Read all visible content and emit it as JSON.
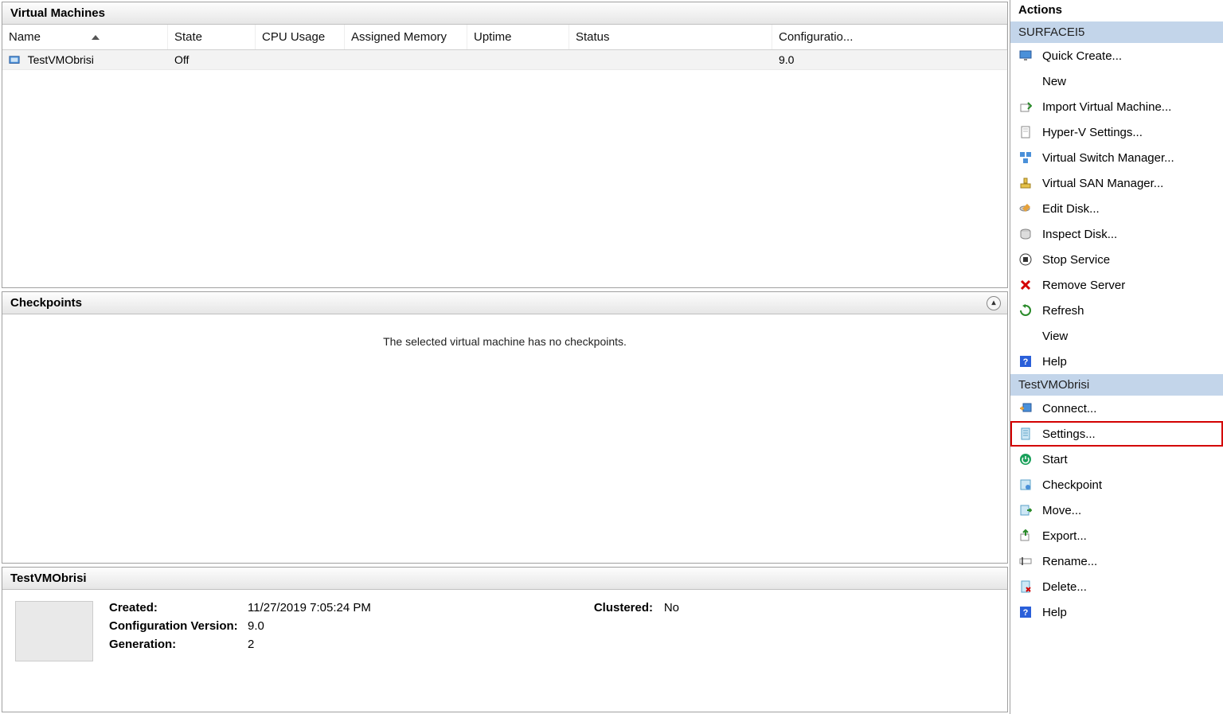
{
  "main": {
    "vm_panel_title": "Virtual Machines",
    "columns": {
      "name": "Name",
      "state": "State",
      "cpu": "CPU Usage",
      "mem": "Assigned Memory",
      "uptime": "Uptime",
      "status": "Status",
      "config": "Configuratio..."
    },
    "rows": [
      {
        "name": "TestVMObrisi",
        "state": "Off",
        "cpu": "",
        "mem": "",
        "uptime": "",
        "status": "",
        "config": "9.0"
      }
    ],
    "checkpoints_title": "Checkpoints",
    "checkpoints_empty": "The selected virtual machine has no checkpoints.",
    "details_title": "TestVMObrisi",
    "details": {
      "created_label": "Created:",
      "created_value": "11/27/2019 7:05:24 PM",
      "configver_label": "Configuration Version:",
      "configver_value": "9.0",
      "generation_label": "Generation:",
      "generation_value": "2",
      "clustered_label": "Clustered:",
      "clustered_value": "No"
    }
  },
  "actions": {
    "title": "Actions",
    "host_header": "SURFACEI5",
    "host_items": [
      {
        "id": "quick-create",
        "label": "Quick Create...",
        "icon": "monitor"
      },
      {
        "id": "new",
        "label": "New",
        "icon": ""
      },
      {
        "id": "import-vm",
        "label": "Import Virtual Machine...",
        "icon": "import"
      },
      {
        "id": "hyperv-settings",
        "label": "Hyper-V Settings...",
        "icon": "sheet"
      },
      {
        "id": "vswitch",
        "label": "Virtual Switch Manager...",
        "icon": "switch"
      },
      {
        "id": "vsan",
        "label": "Virtual SAN Manager...",
        "icon": "san"
      },
      {
        "id": "edit-disk",
        "label": "Edit Disk...",
        "icon": "disk-edit"
      },
      {
        "id": "inspect-disk",
        "label": "Inspect Disk...",
        "icon": "disk"
      },
      {
        "id": "stop-service",
        "label": "Stop Service",
        "icon": "stop"
      },
      {
        "id": "remove-server",
        "label": "Remove Server",
        "icon": "x"
      },
      {
        "id": "refresh",
        "label": "Refresh",
        "icon": "refresh"
      },
      {
        "id": "view",
        "label": "View",
        "icon": ""
      },
      {
        "id": "help-host",
        "label": "Help",
        "icon": "help"
      }
    ],
    "vm_header": "TestVMObrisi",
    "vm_items": [
      {
        "id": "connect",
        "label": "Connect...",
        "icon": "connect"
      },
      {
        "id": "settings",
        "label": "Settings...",
        "icon": "settings-sheet",
        "highlight": true
      },
      {
        "id": "start",
        "label": "Start",
        "icon": "power"
      },
      {
        "id": "checkpoint",
        "label": "Checkpoint",
        "icon": "checkpoint"
      },
      {
        "id": "move",
        "label": "Move...",
        "icon": "move"
      },
      {
        "id": "export",
        "label": "Export...",
        "icon": "export"
      },
      {
        "id": "rename",
        "label": "Rename...",
        "icon": "rename"
      },
      {
        "id": "delete",
        "label": "Delete...",
        "icon": "delete"
      },
      {
        "id": "help-vm",
        "label": "Help",
        "icon": "help"
      }
    ]
  }
}
